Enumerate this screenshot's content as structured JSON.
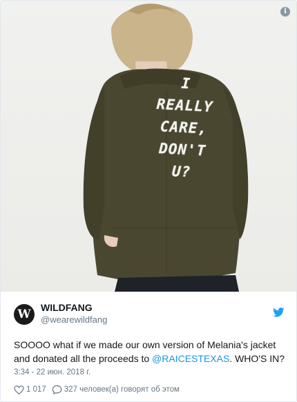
{
  "photo": {
    "jacket_lines": [
      "I",
      "REALLY",
      "CARE,",
      "DON'T",
      "U?"
    ],
    "info_icon": "i"
  },
  "tweet": {
    "display_name": "WILDFANG",
    "handle": "@wearewildfang",
    "avatar_text": "W",
    "text_before": "SOOOO what if we made our own version of Melania's jacket and donated all the proceeds to ",
    "mention": "@RAICESTEXAS",
    "text_after": ". WHO'S IN?",
    "timestamp": "3:34 - 22 июн. 2018 г.",
    "likes": "1 017",
    "replies_text": "327 человек(а) говорят об этом"
  },
  "colors": {
    "jacket": "#4a4730",
    "link": "#1b95e0",
    "twitter_blue": "#1da1f2",
    "muted": "#657786"
  },
  "icons": [
    "info-icon",
    "twitter-bird-icon",
    "heart-icon",
    "speech-bubble-icon"
  ]
}
